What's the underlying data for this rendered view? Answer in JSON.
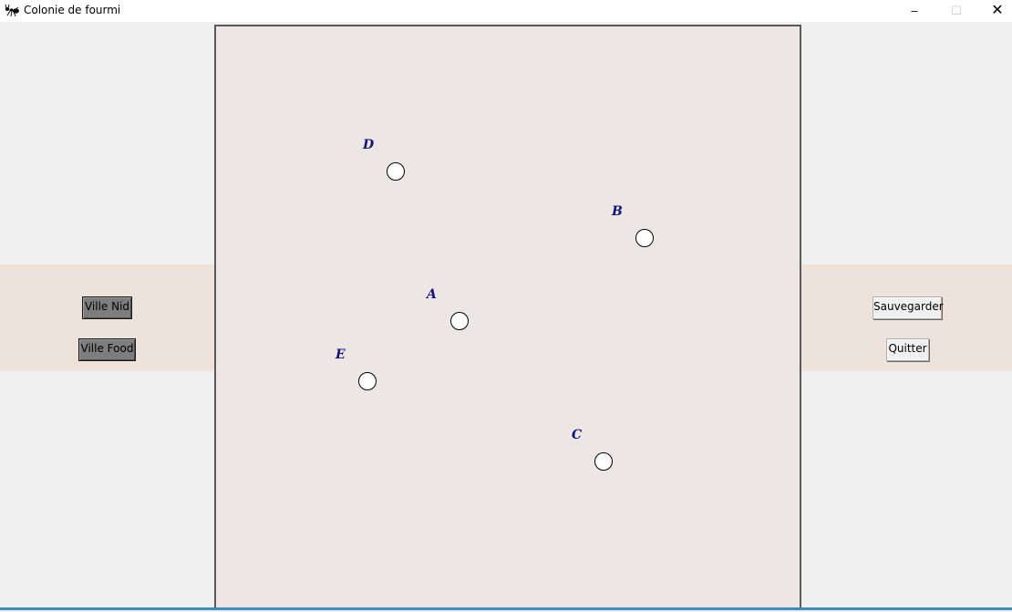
{
  "window": {
    "title": "Colonie de fourmi",
    "app_icon": "ant-icon",
    "controls": {
      "minimize": "–",
      "maximize": "☐",
      "close": "✕"
    }
  },
  "left_panel": {
    "ville_nid_label": "Ville Nid",
    "ville_food_label": "Ville Food"
  },
  "right_panel": {
    "save_label": "Sauvegarder",
    "quit_label": "Quitter"
  },
  "cities": [
    {
      "name": "D"
    },
    {
      "name": "B"
    },
    {
      "name": "A"
    },
    {
      "name": "E"
    },
    {
      "name": "C"
    }
  ],
  "colors": {
    "canvas_bg": "#ece7e5",
    "label_color": "#10107a",
    "panel_band": "#ede3da"
  }
}
